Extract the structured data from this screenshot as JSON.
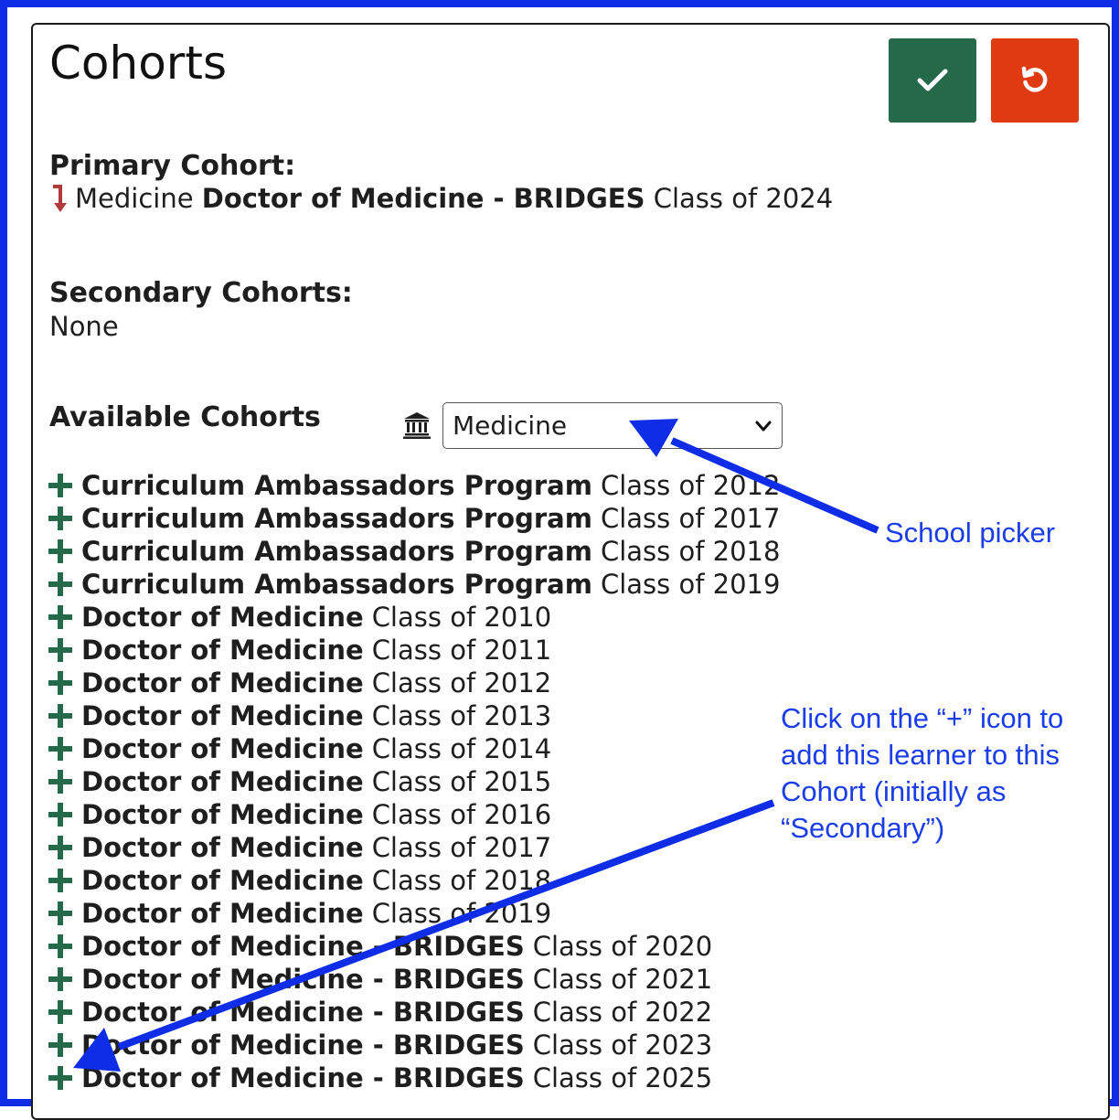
{
  "header": {
    "title": "Cohorts"
  },
  "buttons": {
    "save_icon": "check-icon",
    "cancel_icon": "undo-icon",
    "save_color": "#24694a",
    "cancel_color": "#e03a12"
  },
  "primary": {
    "label": "Primary Cohort:",
    "school": "Medicine",
    "program": "Doctor of Medicine - BRIDGES",
    "class": "Class of 2024",
    "icon": "level-down-arrow-icon"
  },
  "secondary": {
    "label": "Secondary Cohorts:",
    "value": "None"
  },
  "available": {
    "label": "Available Cohorts",
    "school_icon": "institution-icon",
    "school_select": "Medicine",
    "items": [
      {
        "program": "Curriculum Ambassadors Program",
        "class": "Class of 2012"
      },
      {
        "program": "Curriculum Ambassadors Program",
        "class": "Class of 2017"
      },
      {
        "program": "Curriculum Ambassadors Program",
        "class": "Class of 2018"
      },
      {
        "program": "Curriculum Ambassadors Program",
        "class": "Class of 2019"
      },
      {
        "program": "Doctor of Medicine",
        "class": "Class of 2010"
      },
      {
        "program": "Doctor of Medicine",
        "class": "Class of 2011"
      },
      {
        "program": "Doctor of Medicine",
        "class": "Class of 2012"
      },
      {
        "program": "Doctor of Medicine",
        "class": "Class of 2013"
      },
      {
        "program": "Doctor of Medicine",
        "class": "Class of 2014"
      },
      {
        "program": "Doctor of Medicine",
        "class": "Class of 2015"
      },
      {
        "program": "Doctor of Medicine",
        "class": "Class of 2016"
      },
      {
        "program": "Doctor of Medicine",
        "class": "Class of 2017"
      },
      {
        "program": "Doctor of Medicine",
        "class": "Class of 2018"
      },
      {
        "program": "Doctor of Medicine",
        "class": "Class of 2019"
      },
      {
        "program": "Doctor of Medicine - BRIDGES",
        "class": "Class of 2020"
      },
      {
        "program": "Doctor of Medicine - BRIDGES",
        "class": "Class of 2021"
      },
      {
        "program": "Doctor of Medicine - BRIDGES",
        "class": "Class of 2022"
      },
      {
        "program": "Doctor of Medicine - BRIDGES",
        "class": "Class of 2023"
      },
      {
        "program": "Doctor of Medicine - BRIDGES",
        "class": "Class of 2025"
      }
    ]
  },
  "annotations": {
    "school_picker": "School picker",
    "plus_hint": "Click on the “+” icon to add this learner to this Cohort (initially as “Secondary”)",
    "color": "#1a3de8"
  }
}
